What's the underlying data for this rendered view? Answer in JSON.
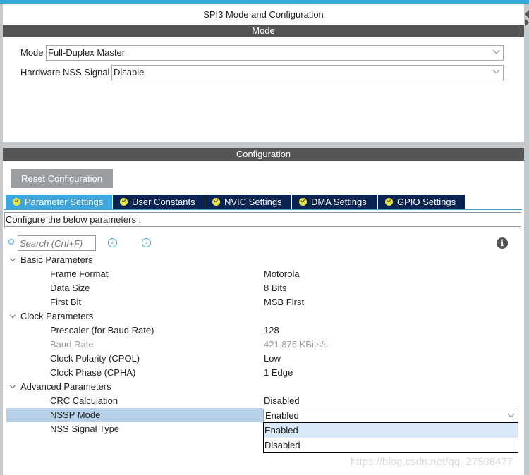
{
  "title": "SPI3 Mode and Configuration",
  "mode_section": {
    "header": "Mode",
    "mode_label": "Mode",
    "mode_value": "Full-Duplex Master",
    "nss_label": "Hardware NSS Signal",
    "nss_value": "Disable"
  },
  "config_section": {
    "header": "Configuration",
    "reset_label": "Reset Configuration",
    "tabs": [
      {
        "label": "Parameter Settings",
        "active": true
      },
      {
        "label": "User Constants"
      },
      {
        "label": "NVIC Settings"
      },
      {
        "label": "DMA Settings"
      },
      {
        "label": "GPIO Settings"
      }
    ],
    "hint": "Configure the below parameters :",
    "search_placeholder": "Search (Crtl+F)",
    "tree": [
      {
        "label": "Basic Parameters",
        "group": true
      },
      {
        "label": "Frame Format",
        "value": "Motorola"
      },
      {
        "label": "Data Size",
        "value": "8 Bits"
      },
      {
        "label": "First Bit",
        "value": "MSB First"
      },
      {
        "label": "Clock Parameters",
        "group": true
      },
      {
        "label": "Prescaler (for Baud Rate)",
        "value": "128"
      },
      {
        "label": "Baud Rate",
        "value": "421.875 KBits/s",
        "disabled": true
      },
      {
        "label": "Clock Polarity (CPOL)",
        "value": "Low"
      },
      {
        "label": "Clock Phase (CPHA)",
        "value": "1 Edge"
      },
      {
        "label": "Advanced Parameters",
        "group": true
      },
      {
        "label": "CRC Calculation",
        "value": "Disabled"
      },
      {
        "label": "NSSP Mode",
        "value": "Enabled",
        "selected": true
      },
      {
        "label": "NSS Signal Type",
        "value": ""
      }
    ],
    "dropdown_options": [
      "Enabled",
      "Disabled"
    ]
  },
  "watermark": "https://blog.csdn.net/qq_27508477",
  "colors": {
    "accent": "#39a7db",
    "tab_dark": "#0a2452",
    "header": "#545554",
    "selected_row": "#b9d1e8"
  }
}
